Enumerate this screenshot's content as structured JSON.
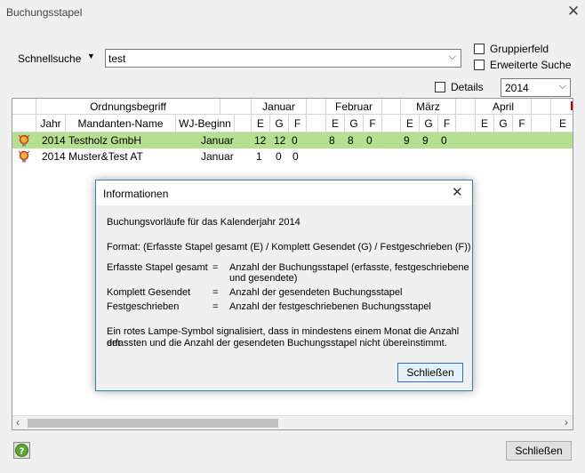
{
  "window": {
    "title": "Buchungsstapel"
  },
  "search": {
    "label": "Schnellsuche",
    "value": "test"
  },
  "options": {
    "group_field": "Gruppierfeld",
    "advanced_search": "Erweiterte Suche",
    "details": "Details",
    "year": "2014"
  },
  "grid": {
    "group_headers": [
      "Ordnungsbegriff",
      "Januar",
      "Februar",
      "März",
      "April"
    ],
    "columns": [
      "Jahr",
      "Mandanten-Name",
      "WJ-Beginn"
    ],
    "sub": [
      "E",
      "G",
      "F"
    ],
    "rows": [
      {
        "year": "2014",
        "name": "Testholz GmbH",
        "start": "Januar",
        "jan": [
          "12",
          "12",
          "0"
        ],
        "feb": [
          "8",
          "8",
          "0"
        ],
        "mar": [
          "9",
          "9",
          "0"
        ]
      },
      {
        "year": "2014",
        "name": "Muster&Test AT",
        "start": "Januar",
        "jan": [
          "1",
          "0",
          "0"
        ],
        "feb": [
          "",
          "",
          ""
        ],
        "mar": [
          "",
          "",
          ""
        ]
      }
    ]
  },
  "dialog": {
    "title": "Informationen",
    "line1": "Buchungsvorläufe für das Kalenderjahr 2014",
    "format": "Format: (Erfasste Stapel gesamt (E) / Komplett Gesendet (G) / Festgeschrieben (F))",
    "defs": [
      {
        "term": "Erfasste Stapel gesamt",
        "eq": "=",
        "desc1": "Anzahl der Buchungsstapel (erfasste, festgeschriebene",
        "desc2": "und gesendete)"
      },
      {
        "term": "Komplett Gesendet",
        "eq": "=",
        "desc1": "Anzahl der gesendeten Buchungsstapel",
        "desc2": ""
      },
      {
        "term": "Festgeschrieben",
        "eq": "=",
        "desc1": "Anzahl der festgeschriebenen Buchungsstapel",
        "desc2": ""
      }
    ],
    "note1": "Ein rotes Lampe-Symbol signalisiert, dass in mindestens einem Monat die Anzahl der",
    "note2": "erfassten und die Anzahl der gesendeten Buchungsstapel nicht übereinstimmt.",
    "close_label": "Schließen"
  },
  "footer": {
    "close_label": "Schließen"
  },
  "colors": {
    "row_highlight": "#b6e08f",
    "dialog_border": "#3c7fb1",
    "button_focus": "#2a70c8"
  }
}
